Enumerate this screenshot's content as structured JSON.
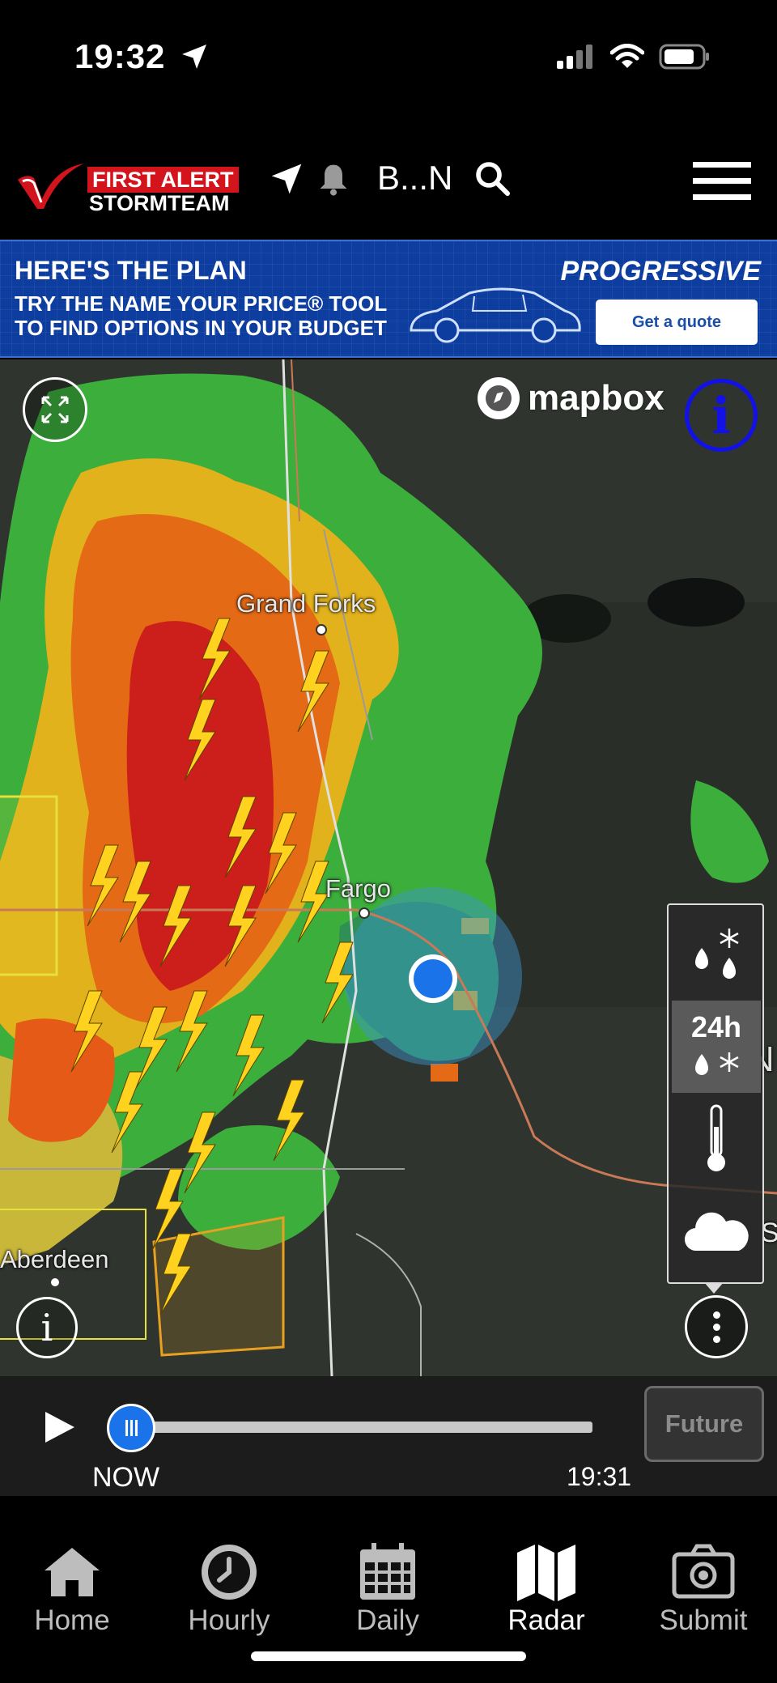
{
  "status_bar": {
    "time": "19:32",
    "icons": [
      "location-arrow-icon",
      "signal-icon",
      "wifi-icon",
      "battery-icon"
    ]
  },
  "header": {
    "logo_line1": "FIRST ALERT",
    "logo_line2": "STORMTEAM",
    "location": "B...N",
    "icons": [
      "navigation-arrow-icon",
      "bell-icon",
      "search-icon",
      "hamburger-menu-icon"
    ]
  },
  "ad": {
    "headline": "HERE'S THE PLAN",
    "line1": "TRY THE NAME YOUR PRICE® TOOL",
    "line2": "TO FIND OPTIONS IN YOUR BUDGET",
    "brand": "PROGRESSIVE",
    "cta": "Get a quote"
  },
  "map": {
    "attribution": "mapbox",
    "info_glyph": "i",
    "labels": {
      "grand_forks": "Grand Forks",
      "fargo": "Fargo",
      "aberdeen": "Aberdeen",
      "edge_mn": "MIN",
      "edge_s": "S"
    },
    "accent_color": "#1a73e8",
    "info_color": "#1212e8"
  },
  "layers": {
    "items": [
      "precipitation-type-layer",
      "24h-precipitation-layer",
      "temperature-layer",
      "cloud-layer"
    ],
    "label_24h": "24h",
    "active": "24h-precipitation-layer"
  },
  "timeline": {
    "now_label": "NOW",
    "time_label": "19:31",
    "future_label": "Future",
    "progress": 0
  },
  "bottom_nav": {
    "items": [
      {
        "label": "Home",
        "icon": "home-icon"
      },
      {
        "label": "Hourly",
        "icon": "clock-icon"
      },
      {
        "label": "Daily",
        "icon": "calendar-icon"
      },
      {
        "label": "Radar",
        "icon": "map-icon"
      },
      {
        "label": "Submit",
        "icon": "camera-icon"
      }
    ],
    "active": "Radar"
  }
}
